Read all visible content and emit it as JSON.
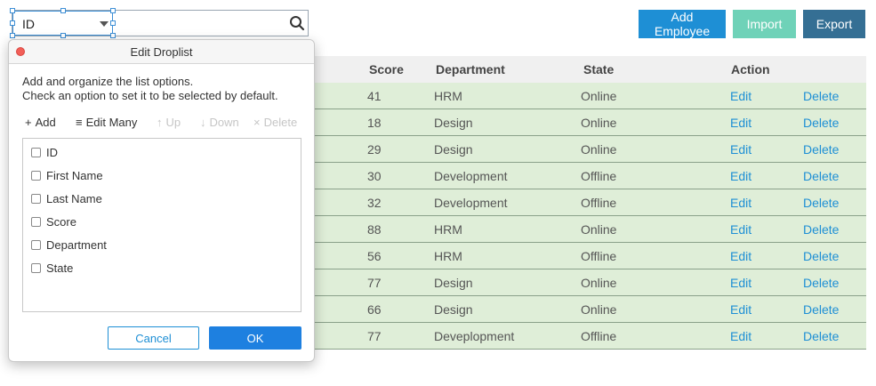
{
  "search": {
    "dropdown_value": "ID"
  },
  "toolbar": {
    "add_employee": "Add Employee",
    "import": "Import",
    "export": "Export"
  },
  "table": {
    "headers": {
      "score": "Score",
      "department": "Department",
      "state": "State",
      "action": "Action"
    },
    "rows": [
      {
        "score": "41",
        "department": "HRM",
        "state": "Online",
        "edit": "Edit",
        "delete": "Delete"
      },
      {
        "score": "18",
        "department": "Design",
        "state": "Online",
        "edit": "Edit",
        "delete": "Delete"
      },
      {
        "score": "29",
        "department": "Design",
        "state": "Online",
        "edit": "Edit",
        "delete": "Delete"
      },
      {
        "score": "30",
        "department": "Development",
        "state": "Offline",
        "edit": "Edit",
        "delete": "Delete"
      },
      {
        "score": "32",
        "department": "Development",
        "state": "Offline",
        "edit": "Edit",
        "delete": "Delete"
      },
      {
        "score": "88",
        "department": "HRM",
        "state": "Online",
        "edit": "Edit",
        "delete": "Delete"
      },
      {
        "score": "56",
        "department": "HRM",
        "state": "Offline",
        "edit": "Edit",
        "delete": "Delete"
      },
      {
        "score": "77",
        "department": "Design",
        "state": "Online",
        "edit": "Edit",
        "delete": "Delete"
      },
      {
        "score": "66",
        "department": "Design",
        "state": "Online",
        "edit": "Edit",
        "delete": "Delete"
      },
      {
        "score": "77",
        "department": "Deveplopment",
        "state": "Offline",
        "edit": "Edit",
        "delete": "Delete"
      }
    ]
  },
  "dialog": {
    "title": "Edit Droplist",
    "desc_line1": "Add and organize the list options.",
    "desc_line2": "Check an option to set it to be selected by default.",
    "tools": {
      "add": "Add",
      "edit_many": "Edit Many",
      "up": "Up",
      "down": "Down",
      "delete": "Delete"
    },
    "options": [
      {
        "label": "ID",
        "checked": false
      },
      {
        "label": "First Name",
        "checked": false
      },
      {
        "label": "Last Name",
        "checked": false
      },
      {
        "label": "Score",
        "checked": false
      },
      {
        "label": "Department",
        "checked": false
      },
      {
        "label": "State",
        "checked": false
      }
    ],
    "cancel": "Cancel",
    "ok": "OK"
  },
  "colors": {
    "primary": "#1e8fd5",
    "import_btn": "#6fd2b8",
    "export_btn": "#356f94",
    "row_bg": "#dfeed8",
    "close_dot": "#f25f58"
  }
}
